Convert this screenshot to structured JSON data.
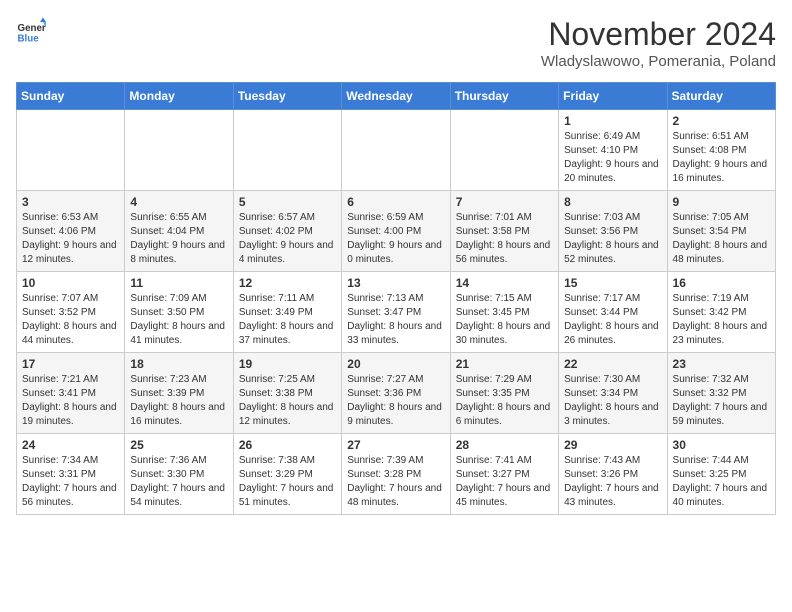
{
  "header": {
    "logo_general": "General",
    "logo_blue": "Blue",
    "month_title": "November 2024",
    "location": "Wladyslawowo, Pomerania, Poland"
  },
  "weekdays": [
    "Sunday",
    "Monday",
    "Tuesday",
    "Wednesday",
    "Thursday",
    "Friday",
    "Saturday"
  ],
  "weeks": [
    [
      {
        "day": "",
        "info": ""
      },
      {
        "day": "",
        "info": ""
      },
      {
        "day": "",
        "info": ""
      },
      {
        "day": "",
        "info": ""
      },
      {
        "day": "",
        "info": ""
      },
      {
        "day": "1",
        "info": "Sunrise: 6:49 AM\nSunset: 4:10 PM\nDaylight: 9 hours and 20 minutes."
      },
      {
        "day": "2",
        "info": "Sunrise: 6:51 AM\nSunset: 4:08 PM\nDaylight: 9 hours and 16 minutes."
      }
    ],
    [
      {
        "day": "3",
        "info": "Sunrise: 6:53 AM\nSunset: 4:06 PM\nDaylight: 9 hours and 12 minutes."
      },
      {
        "day": "4",
        "info": "Sunrise: 6:55 AM\nSunset: 4:04 PM\nDaylight: 9 hours and 8 minutes."
      },
      {
        "day": "5",
        "info": "Sunrise: 6:57 AM\nSunset: 4:02 PM\nDaylight: 9 hours and 4 minutes."
      },
      {
        "day": "6",
        "info": "Sunrise: 6:59 AM\nSunset: 4:00 PM\nDaylight: 9 hours and 0 minutes."
      },
      {
        "day": "7",
        "info": "Sunrise: 7:01 AM\nSunset: 3:58 PM\nDaylight: 8 hours and 56 minutes."
      },
      {
        "day": "8",
        "info": "Sunrise: 7:03 AM\nSunset: 3:56 PM\nDaylight: 8 hours and 52 minutes."
      },
      {
        "day": "9",
        "info": "Sunrise: 7:05 AM\nSunset: 3:54 PM\nDaylight: 8 hours and 48 minutes."
      }
    ],
    [
      {
        "day": "10",
        "info": "Sunrise: 7:07 AM\nSunset: 3:52 PM\nDaylight: 8 hours and 44 minutes."
      },
      {
        "day": "11",
        "info": "Sunrise: 7:09 AM\nSunset: 3:50 PM\nDaylight: 8 hours and 41 minutes."
      },
      {
        "day": "12",
        "info": "Sunrise: 7:11 AM\nSunset: 3:49 PM\nDaylight: 8 hours and 37 minutes."
      },
      {
        "day": "13",
        "info": "Sunrise: 7:13 AM\nSunset: 3:47 PM\nDaylight: 8 hours and 33 minutes."
      },
      {
        "day": "14",
        "info": "Sunrise: 7:15 AM\nSunset: 3:45 PM\nDaylight: 8 hours and 30 minutes."
      },
      {
        "day": "15",
        "info": "Sunrise: 7:17 AM\nSunset: 3:44 PM\nDaylight: 8 hours and 26 minutes."
      },
      {
        "day": "16",
        "info": "Sunrise: 7:19 AM\nSunset: 3:42 PM\nDaylight: 8 hours and 23 minutes."
      }
    ],
    [
      {
        "day": "17",
        "info": "Sunrise: 7:21 AM\nSunset: 3:41 PM\nDaylight: 8 hours and 19 minutes."
      },
      {
        "day": "18",
        "info": "Sunrise: 7:23 AM\nSunset: 3:39 PM\nDaylight: 8 hours and 16 minutes."
      },
      {
        "day": "19",
        "info": "Sunrise: 7:25 AM\nSunset: 3:38 PM\nDaylight: 8 hours and 12 minutes."
      },
      {
        "day": "20",
        "info": "Sunrise: 7:27 AM\nSunset: 3:36 PM\nDaylight: 8 hours and 9 minutes."
      },
      {
        "day": "21",
        "info": "Sunrise: 7:29 AM\nSunset: 3:35 PM\nDaylight: 8 hours and 6 minutes."
      },
      {
        "day": "22",
        "info": "Sunrise: 7:30 AM\nSunset: 3:34 PM\nDaylight: 8 hours and 3 minutes."
      },
      {
        "day": "23",
        "info": "Sunrise: 7:32 AM\nSunset: 3:32 PM\nDaylight: 7 hours and 59 minutes."
      }
    ],
    [
      {
        "day": "24",
        "info": "Sunrise: 7:34 AM\nSunset: 3:31 PM\nDaylight: 7 hours and 56 minutes."
      },
      {
        "day": "25",
        "info": "Sunrise: 7:36 AM\nSunset: 3:30 PM\nDaylight: 7 hours and 54 minutes."
      },
      {
        "day": "26",
        "info": "Sunrise: 7:38 AM\nSunset: 3:29 PM\nDaylight: 7 hours and 51 minutes."
      },
      {
        "day": "27",
        "info": "Sunrise: 7:39 AM\nSunset: 3:28 PM\nDaylight: 7 hours and 48 minutes."
      },
      {
        "day": "28",
        "info": "Sunrise: 7:41 AM\nSunset: 3:27 PM\nDaylight: 7 hours and 45 minutes."
      },
      {
        "day": "29",
        "info": "Sunrise: 7:43 AM\nSunset: 3:26 PM\nDaylight: 7 hours and 43 minutes."
      },
      {
        "day": "30",
        "info": "Sunrise: 7:44 AM\nSunset: 3:25 PM\nDaylight: 7 hours and 40 minutes."
      }
    ]
  ]
}
